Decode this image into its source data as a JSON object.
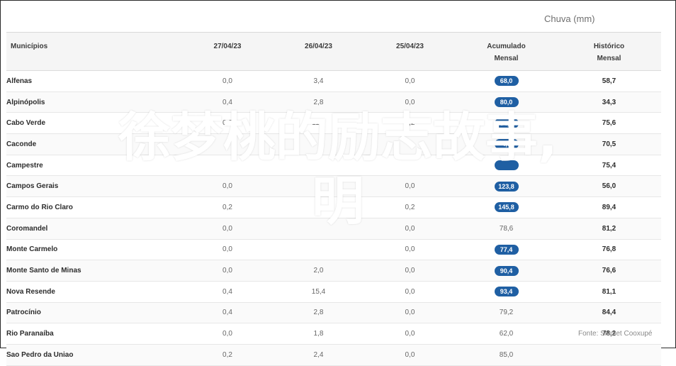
{
  "header": {
    "title": "Chuva (mm)"
  },
  "table": {
    "columns": [
      "Municípios",
      "27/04/23",
      "26/04/23",
      "25/04/23",
      "Acumulado\nMensal",
      "Histórico\nMensal"
    ],
    "rows": [
      {
        "name": "Alfenas",
        "d1": "0,0",
        "d2": "3,4",
        "d3": "0,0",
        "acc": "68,0",
        "hist": "58,7",
        "pill": true
      },
      {
        "name": "Alpinópolis",
        "d1": "0,4",
        "d2": "2,8",
        "d3": "0,0",
        "acc": "80,0",
        "hist": "34,3",
        "pill": true
      },
      {
        "name": "Cabo Verde",
        "d1": "0,2",
        "d2": "11,4",
        "d3": "0,2",
        "acc": "94,6",
        "hist": "75,6",
        "pill": true
      },
      {
        "name": "Caconde",
        "d1": "",
        "d2": "",
        "d3": "",
        "acc": "4,8",
        "hist": "70,5",
        "pill": true
      },
      {
        "name": "Campestre",
        "d1": "",
        "d2": "",
        "d3": "",
        "acc": "",
        "hist": "75,4",
        "pill": true
      },
      {
        "name": "Campos Gerais",
        "d1": "0,0",
        "d2": "",
        "d3": "0,0",
        "acc": "123,8",
        "hist": "56,0",
        "pill": true
      },
      {
        "name": "Carmo do Rio Claro",
        "d1": "0,2",
        "d2": "",
        "d3": "0,2",
        "acc": "145,8",
        "hist": "89,4",
        "pill": true
      },
      {
        "name": "Coromandel",
        "d1": "0,0",
        "d2": "",
        "d3": "0,0",
        "acc": "78,6",
        "hist": "81,2",
        "pill": false
      },
      {
        "name": "Monte Carmelo",
        "d1": "0,0",
        "d2": "",
        "d3": "0,0",
        "acc": "77,4",
        "hist": "76,8",
        "pill": true
      },
      {
        "name": "Monte Santo de Minas",
        "d1": "0,0",
        "d2": "2,0",
        "d3": "0,0",
        "acc": "90,4",
        "hist": "76,6",
        "pill": true
      },
      {
        "name": "Nova Resende",
        "d1": "0,4",
        "d2": "15,4",
        "d3": "0,0",
        "acc": "93,4",
        "hist": "81,1",
        "pill": true
      },
      {
        "name": "Patrocínio",
        "d1": "0,4",
        "d2": "2,8",
        "d3": "0,0",
        "acc": "79,2",
        "hist": "84,4",
        "pill": false
      },
      {
        "name": "Rio Paranaíba",
        "d1": "0,0",
        "d2": "1,8",
        "d3": "0,0",
        "acc": "62,0",
        "hist": "78,2",
        "pill": false
      },
      {
        "name": "Sao Pedro da Uniao",
        "d1": "0,2",
        "d2": "2,4",
        "d3": "0,0",
        "acc": "85,0",
        "hist": "",
        "pill": false
      }
    ]
  },
  "footer": {
    "source": "Fonte: Sismet Cooxupé"
  },
  "overlay": {
    "line1": "徐梦桃的励志故事,",
    "line2": "明"
  },
  "colors": {
    "pill": "#1f5fa3",
    "overlay_text": "#ffffff"
  }
}
